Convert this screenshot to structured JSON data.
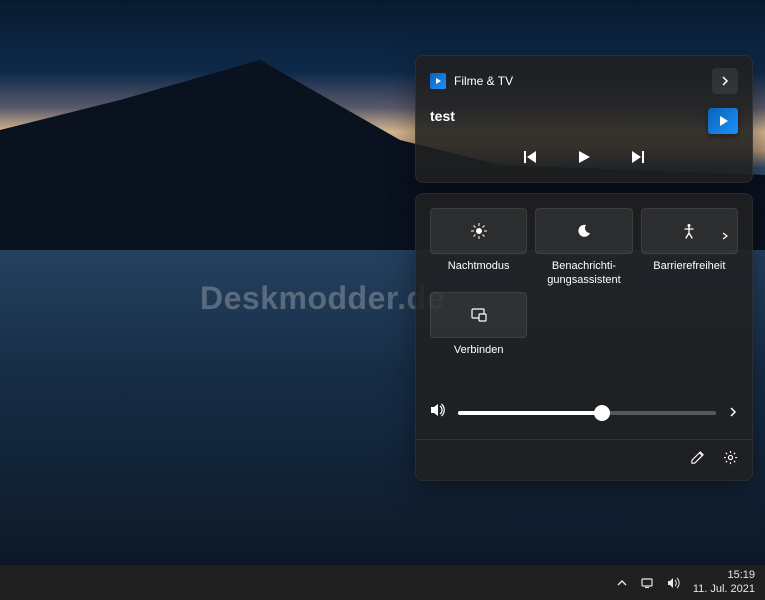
{
  "watermark": "Deskmodder.de",
  "media": {
    "app_name": "Filme & TV",
    "title": "test"
  },
  "qs": {
    "tiles": [
      {
        "label": "Nachtmodus"
      },
      {
        "label": "Benachrichti-\ngungsassistent"
      },
      {
        "label": "Barrierefreiheit"
      },
      {
        "label": "Verbinden"
      }
    ],
    "volume": 56
  },
  "taskbar": {
    "time": "15:19",
    "date": "11. Jul. 2021"
  }
}
